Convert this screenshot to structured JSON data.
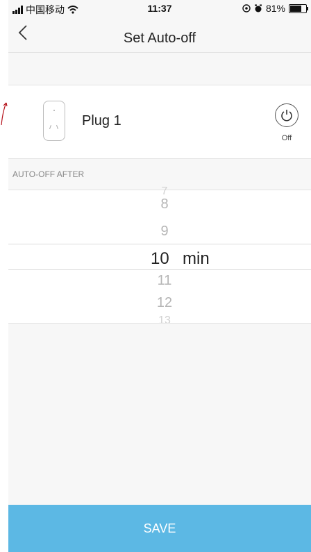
{
  "status_bar": {
    "carrier": "中国移动",
    "time": "11:37",
    "battery": "81%",
    "battery_level": 0.81
  },
  "nav": {
    "back_icon": "chevron-left-icon",
    "title": "Set Auto-off"
  },
  "device": {
    "name": "Plug 1",
    "power_state": "Off"
  },
  "section": {
    "label": "AUTO-OFF AFTER"
  },
  "picker": {
    "items_above": [
      "7",
      "8",
      "9"
    ],
    "selected": "10",
    "unit": "min",
    "items_below": [
      "11",
      "12",
      "13"
    ]
  },
  "actions": {
    "save_label": "SAVE"
  },
  "colors": {
    "accent": "#5cb8e4",
    "background": "#f7f7f7"
  }
}
